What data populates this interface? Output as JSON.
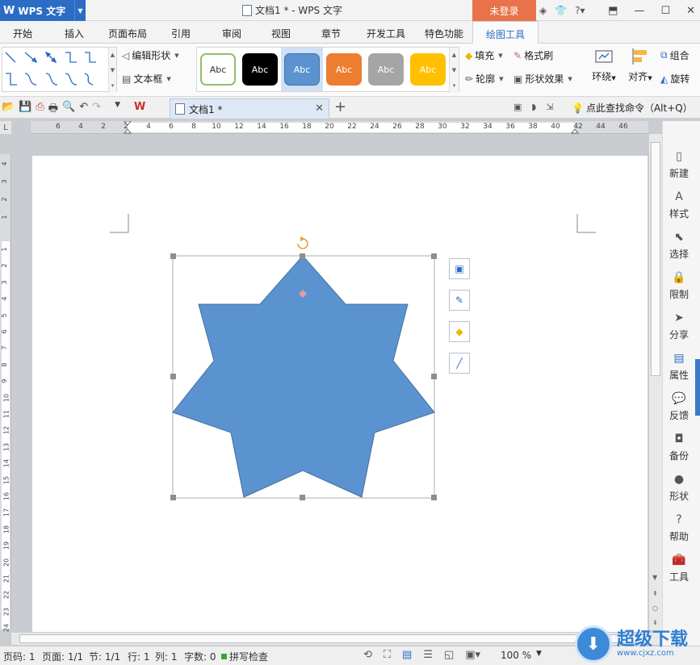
{
  "app": {
    "name": "WPS 文字",
    "window_title": "文档1 * - WPS 文字",
    "login_label": "未登录"
  },
  "ribbon_tabs": [
    "开始",
    "插入",
    "页面布局",
    "引用",
    "审阅",
    "视图",
    "章节",
    "开发工具",
    "特色功能",
    "绘图工具"
  ],
  "ribbon_active_tab": "绘图工具",
  "ribbon": {
    "edit_shape": "编辑形状",
    "text_box": "文本框",
    "style_samples": [
      "Abc",
      "Abc",
      "Abc",
      "Abc",
      "Abc",
      "Abc"
    ],
    "fill": "填充",
    "format_painter": "格式刷",
    "outline": "轮廓",
    "shape_effects": "形状效果",
    "wrap": "环绕",
    "align": "对齐",
    "group": "组合",
    "rotate": "旋转"
  },
  "document_tab": {
    "name": "文档1 *"
  },
  "find_command": "点此查找命令（Alt+Q）",
  "ruler": {
    "h_numbers": [
      "6",
      "4",
      "2",
      "2",
      "4",
      "6",
      "8",
      "10",
      "12",
      "14",
      "16",
      "18",
      "20",
      "22",
      "24",
      "26",
      "28",
      "30",
      "32",
      "34",
      "36",
      "38",
      "40",
      "42",
      "44",
      "46"
    ],
    "v_numbers": [
      "4",
      "3",
      "2",
      "1",
      "1",
      "2",
      "3",
      "4",
      "5",
      "6",
      "7",
      "8",
      "9",
      "10",
      "11",
      "12",
      "13",
      "14",
      "15",
      "16",
      "17",
      "18",
      "19",
      "20",
      "21",
      "22",
      "23",
      "24"
    ]
  },
  "right_pane": [
    "新建",
    "样式",
    "选择",
    "限制",
    "分享",
    "属性",
    "反馈",
    "备份",
    "形状",
    "帮助",
    "工具"
  ],
  "right_pane_active": "属性",
  "status": {
    "page_code": "页码: 1",
    "page": "页面: 1/1",
    "section": "节: 1/1",
    "row": "行: 1",
    "col": "列: 1",
    "word_count": "字数: 0",
    "spell_check": "拼写检查",
    "zoom": "100 %"
  },
  "watermark": {
    "name": "超级下载",
    "url": "www.cjxz.com"
  },
  "colors": {
    "accent": "#2b6cc4",
    "login": "#e8734a",
    "star_fill": "#5b93d0",
    "star_stroke": "#41719c",
    "handle": "#8e8e8e",
    "rotate_handle": "#e8a23a"
  }
}
